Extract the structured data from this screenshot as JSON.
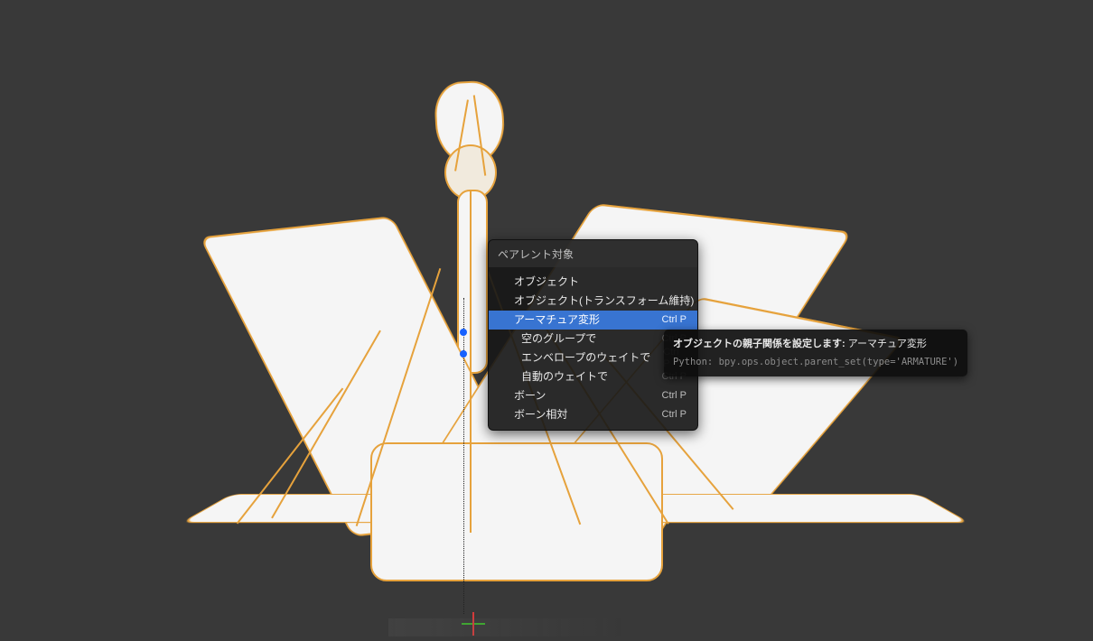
{
  "menu": {
    "title": "ペアレント対象",
    "items": [
      {
        "label": "オブジェクト",
        "shortcut": "",
        "indent": false,
        "highlight": false
      },
      {
        "label": "オブジェクト(トランスフォーム維持)",
        "shortcut": "",
        "indent": false,
        "highlight": false
      },
      {
        "label": "アーマチュア変形",
        "shortcut": "Ctrl P",
        "indent": false,
        "highlight": true
      },
      {
        "label": "空のグループで",
        "shortcut": "Ctrl P",
        "indent": true,
        "highlight": false,
        "dimshortcut": true
      },
      {
        "label": "エンベロープのウェイトで",
        "shortcut": "Ctrl P",
        "indent": true,
        "highlight": false,
        "dimshortcut": true
      },
      {
        "label": "自動のウェイトで",
        "shortcut": "Ctrl P",
        "indent": true,
        "highlight": false,
        "dimshortcut": true
      },
      {
        "label": "ボーン",
        "shortcut": "Ctrl P",
        "indent": false,
        "highlight": false
      },
      {
        "label": "ボーン相対",
        "shortcut": "Ctrl P",
        "indent": false,
        "highlight": false
      }
    ]
  },
  "tooltip": {
    "line1_lead": "オブジェクトの親子関係を設定します: ",
    "line1_tail": "アーマチュア変形",
    "line2": "Python: bpy.ops.object.parent_set(type='ARMATURE')"
  }
}
